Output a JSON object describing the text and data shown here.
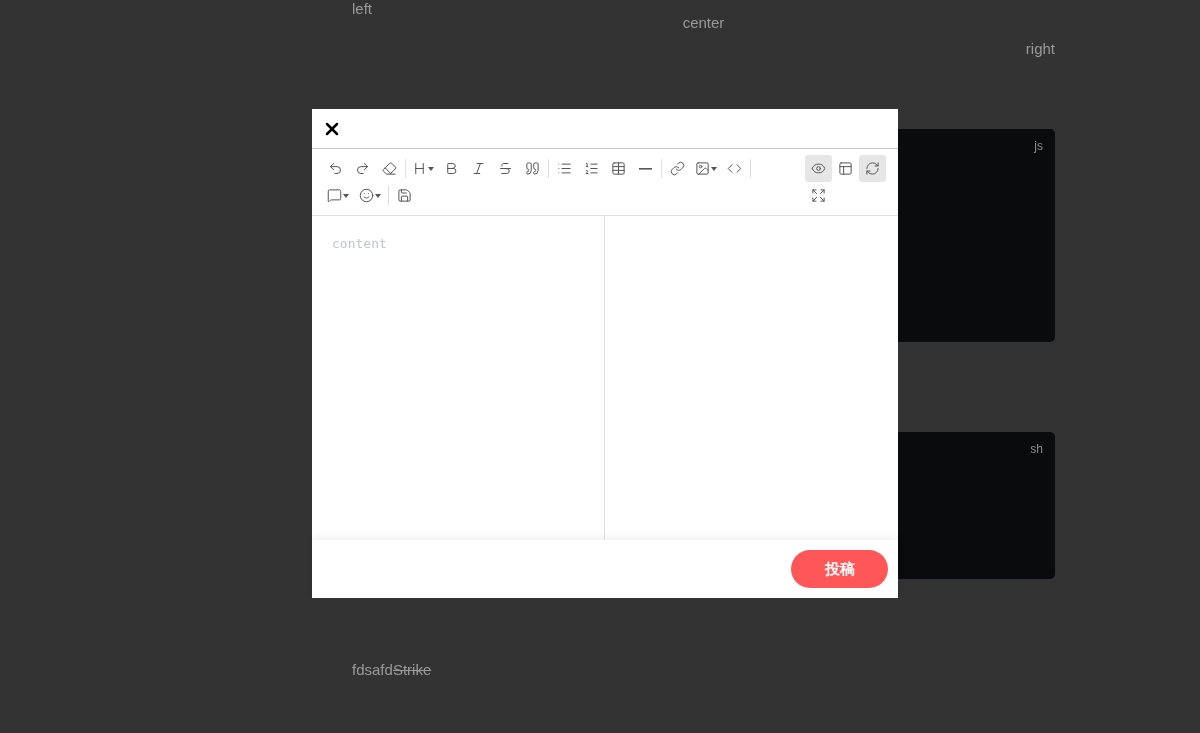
{
  "page": {
    "left_text": "left",
    "center_text": "center",
    "right_text": "right",
    "code_blocks": [
      {
        "language": "js"
      },
      {
        "language": "sh"
      }
    ],
    "bottom_line": [
      {
        "kind": "plain",
        "text": "fdsafd"
      },
      {
        "kind": "strike",
        "text": "Strike"
      }
    ]
  },
  "editor": {
    "placeholder": "content",
    "view_toggles": [
      {
        "kind": "preview",
        "selected": true
      },
      {
        "kind": "html",
        "selected": false
      },
      {
        "kind": "sync",
        "selected": true
      }
    ],
    "submit_label": "投稿"
  }
}
